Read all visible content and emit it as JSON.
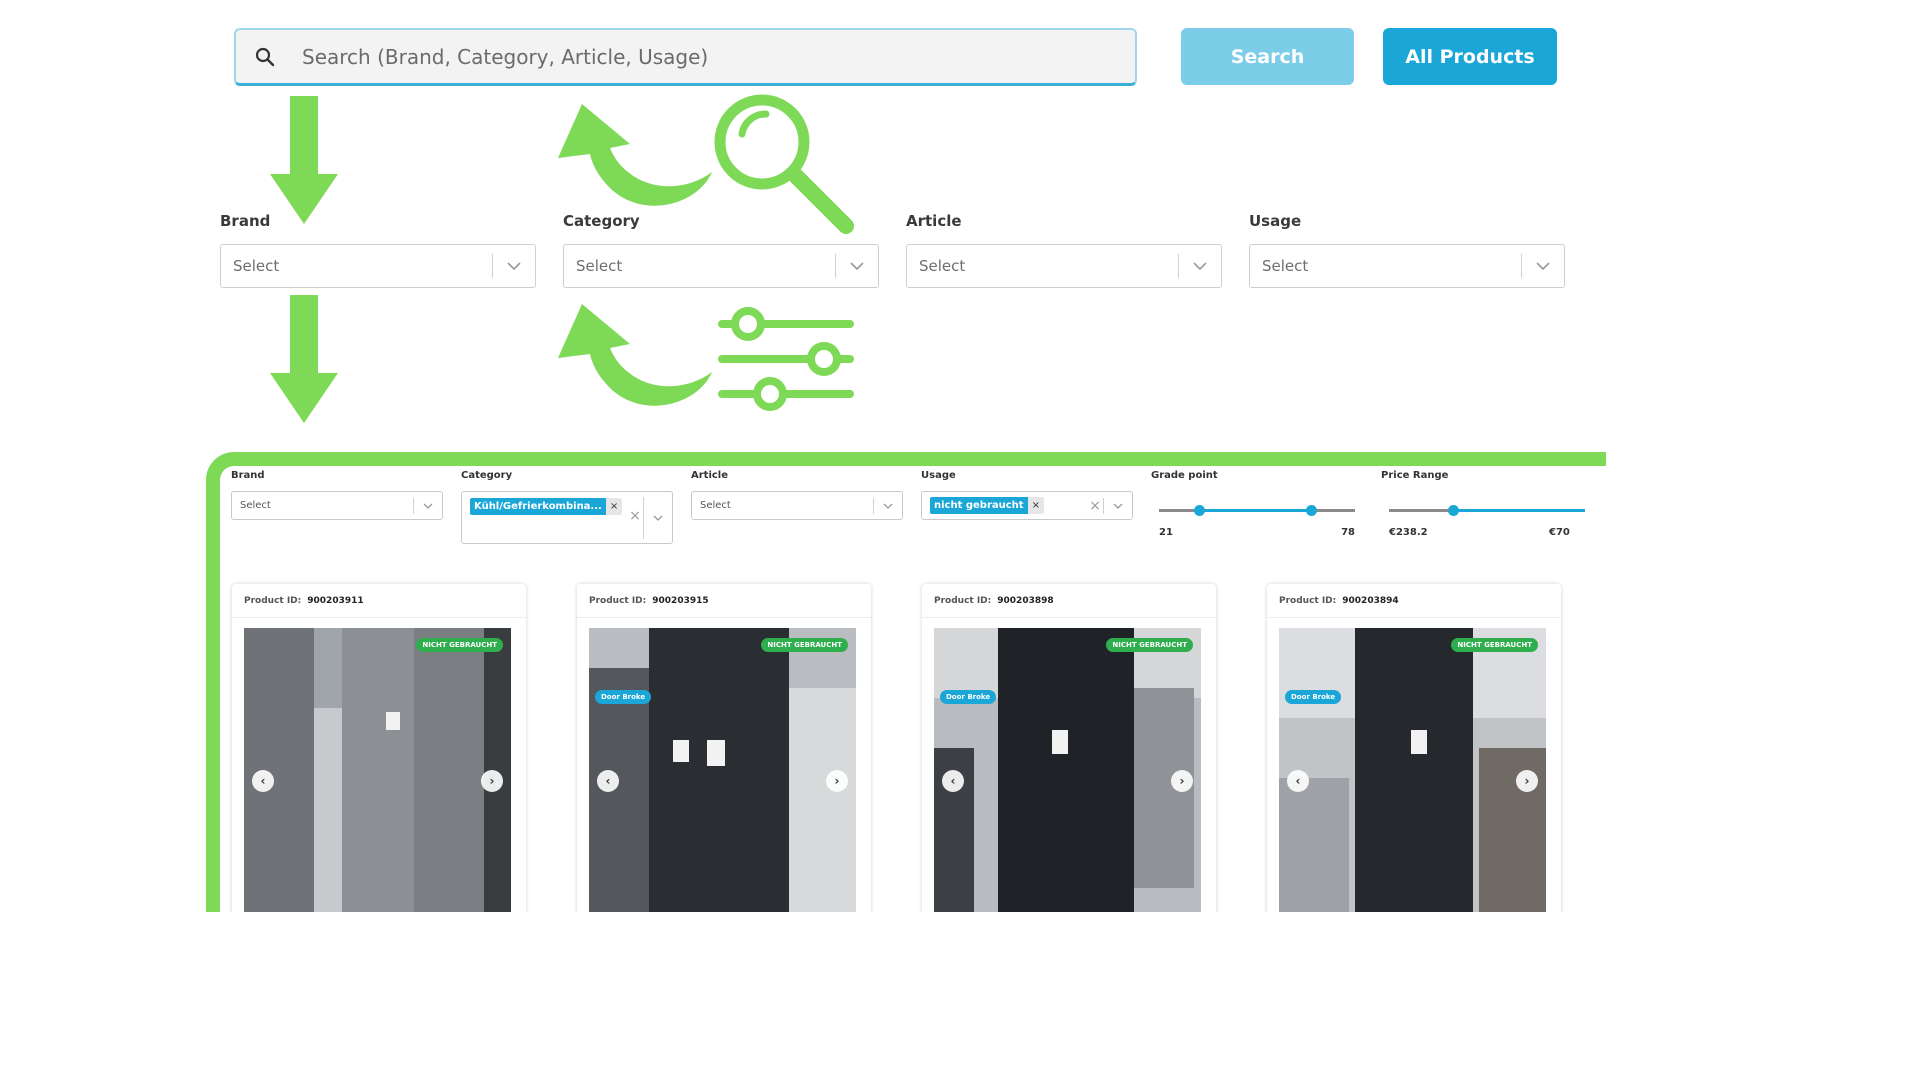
{
  "search": {
    "placeholder": "Search (Brand, Category, Article, Usage)",
    "search_button": "Search",
    "all_products_button": "All Products"
  },
  "filters": [
    {
      "label": "Brand",
      "placeholder": "Select"
    },
    {
      "label": "Category",
      "placeholder": "Select"
    },
    {
      "label": "Article",
      "placeholder": "Select"
    },
    {
      "label": "Usage",
      "placeholder": "Select"
    }
  ],
  "decorations": {
    "accent_color": "#7ed957",
    "icons": [
      "arrow-down-icon",
      "curved-arrow-icon",
      "magnifier-icon",
      "sliders-icon"
    ]
  },
  "panel": {
    "filters": {
      "brand": {
        "label": "Brand",
        "placeholder": "Select"
      },
      "category": {
        "label": "Category",
        "chip": "Kühl/Gefrierkombina...",
        "chip_remove": "×",
        "clear": "×"
      },
      "article": {
        "label": "Article",
        "placeholder": "Select"
      },
      "usage": {
        "label": "Usage",
        "chip": "nicht gebraucht",
        "chip_remove": "×",
        "clear": "×"
      },
      "grade_point": {
        "label": "Grade point",
        "min_label": "21",
        "max_label": "78",
        "low_fraction": 0.21,
        "high_fraction": 0.78
      },
      "price_range": {
        "label": "Price Range",
        "min_label": "€238.2",
        "max_label": "€70"
      }
    },
    "products": [
      {
        "id_label": "Product ID:",
        "id": "900203911",
        "status_badge": "NICHT GEBRAUCHT",
        "damage_badge": "",
        "colors": [
          "#8c9094",
          "#6d7175"
        ]
      },
      {
        "id_label": "Product ID:",
        "id": "900203915",
        "status_badge": "NICHT GEBRAUCHT",
        "damage_badge": "Door Broke",
        "colors": [
          "#2a2d31",
          "#54585c"
        ]
      },
      {
        "id_label": "Product ID:",
        "id": "900203898",
        "status_badge": "NICHT GEBRAUCHT",
        "damage_badge": "Door Broke",
        "colors": [
          "#1f2226",
          "#8f9398"
        ]
      },
      {
        "id_label": "Product ID:",
        "id": "900203894",
        "status_badge": "NICHT GEBRAUCHT",
        "damage_badge": "Door Broke",
        "colors": [
          "#25282c",
          "#9ea2a6"
        ]
      }
    ],
    "nav": {
      "prev": "‹",
      "next": "›"
    }
  }
}
